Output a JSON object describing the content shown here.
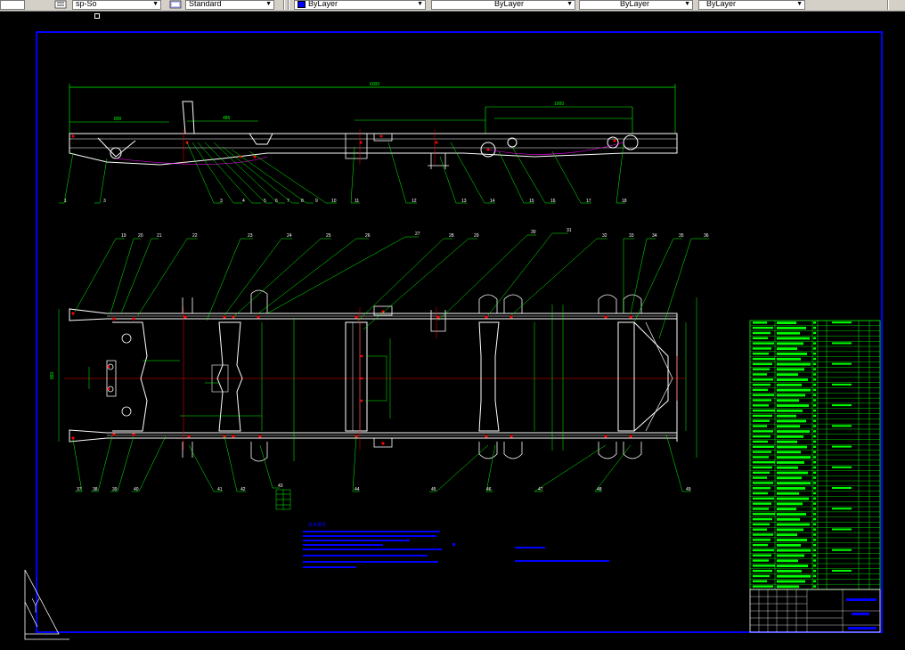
{
  "toolbar": {
    "linetype_value": "sp-So",
    "textstyle_value": "Standard",
    "color_value": "ByLayer",
    "layer_value": "ByLayer",
    "lineweight_value": "ByLayer",
    "plotstyle_value": "ByLayer",
    "dropdown_arrow": "▼"
  },
  "colors": {
    "background": "#000000",
    "border": "#0000ff",
    "geometry": "#ffffff",
    "dimension": "#00ff00",
    "centerline": "#ff0000",
    "annotation": "#0000ff",
    "marker": "#ff00ff"
  },
  "top_view": {
    "dim_overall": "6000",
    "dim_left": "800",
    "dim_mid": "485",
    "dim_right": "1000",
    "callouts": [
      "1",
      "3",
      "3",
      "4",
      "5",
      "6",
      "7",
      "8",
      "9",
      "10",
      "11",
      "12",
      "13",
      "14",
      "15",
      "16",
      "17",
      "18"
    ]
  },
  "plan_view": {
    "callouts_top": [
      "19",
      "20",
      "21",
      "22",
      "23",
      "24",
      "25",
      "26",
      "27",
      "28",
      "29",
      "30",
      "31",
      "32",
      "33",
      "34",
      "35",
      "36"
    ],
    "callouts_bottom": [
      "37",
      "38",
      "39",
      "40",
      "41",
      "42",
      "43",
      "44",
      "45",
      "46",
      "47",
      "48",
      "49",
      "50",
      "51"
    ],
    "dim_width": "860"
  },
  "notes": {
    "heading": "技术要求"
  },
  "title_block": {
    "company": "",
    "part_name": "",
    "drawing_no": ""
  }
}
